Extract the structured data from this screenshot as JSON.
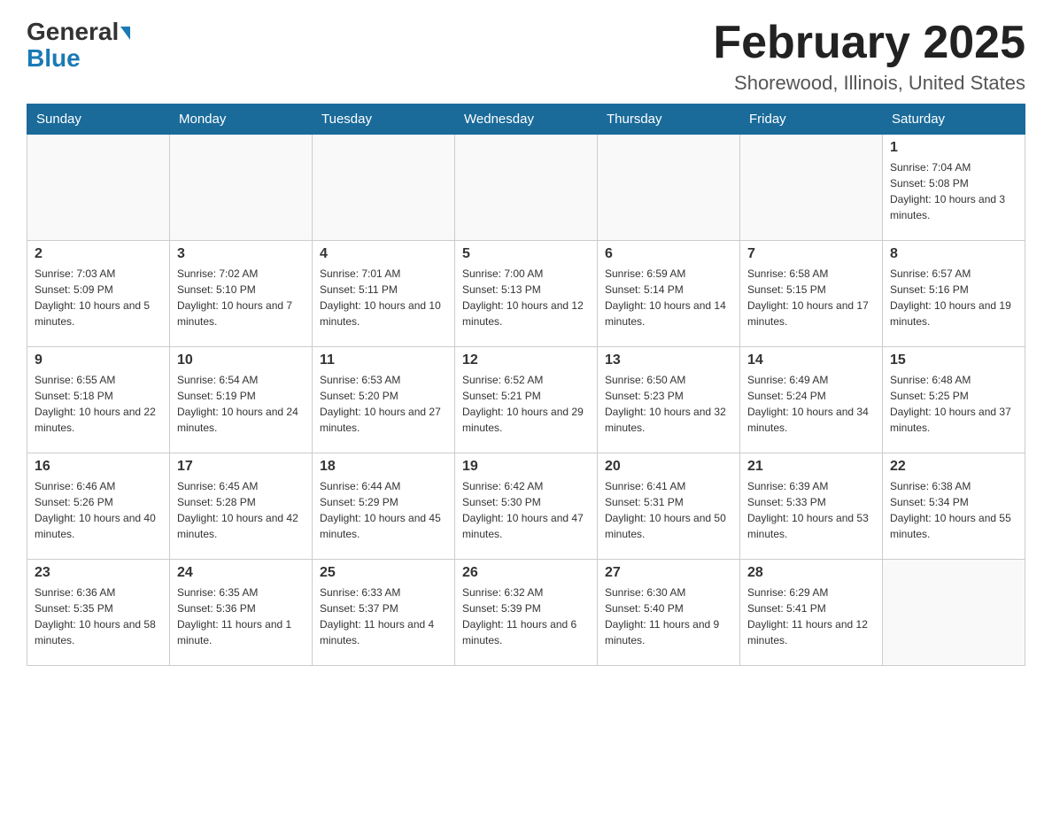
{
  "logo": {
    "general": "General",
    "blue": "Blue"
  },
  "header": {
    "month_year": "February 2025",
    "location": "Shorewood, Illinois, United States"
  },
  "weekdays": [
    "Sunday",
    "Monday",
    "Tuesday",
    "Wednesday",
    "Thursday",
    "Friday",
    "Saturday"
  ],
  "weeks": [
    [
      {
        "day": "",
        "info": ""
      },
      {
        "day": "",
        "info": ""
      },
      {
        "day": "",
        "info": ""
      },
      {
        "day": "",
        "info": ""
      },
      {
        "day": "",
        "info": ""
      },
      {
        "day": "",
        "info": ""
      },
      {
        "day": "1",
        "info": "Sunrise: 7:04 AM\nSunset: 5:08 PM\nDaylight: 10 hours and 3 minutes."
      }
    ],
    [
      {
        "day": "2",
        "info": "Sunrise: 7:03 AM\nSunset: 5:09 PM\nDaylight: 10 hours and 5 minutes."
      },
      {
        "day": "3",
        "info": "Sunrise: 7:02 AM\nSunset: 5:10 PM\nDaylight: 10 hours and 7 minutes."
      },
      {
        "day": "4",
        "info": "Sunrise: 7:01 AM\nSunset: 5:11 PM\nDaylight: 10 hours and 10 minutes."
      },
      {
        "day": "5",
        "info": "Sunrise: 7:00 AM\nSunset: 5:13 PM\nDaylight: 10 hours and 12 minutes."
      },
      {
        "day": "6",
        "info": "Sunrise: 6:59 AM\nSunset: 5:14 PM\nDaylight: 10 hours and 14 minutes."
      },
      {
        "day": "7",
        "info": "Sunrise: 6:58 AM\nSunset: 5:15 PM\nDaylight: 10 hours and 17 minutes."
      },
      {
        "day": "8",
        "info": "Sunrise: 6:57 AM\nSunset: 5:16 PM\nDaylight: 10 hours and 19 minutes."
      }
    ],
    [
      {
        "day": "9",
        "info": "Sunrise: 6:55 AM\nSunset: 5:18 PM\nDaylight: 10 hours and 22 minutes."
      },
      {
        "day": "10",
        "info": "Sunrise: 6:54 AM\nSunset: 5:19 PM\nDaylight: 10 hours and 24 minutes."
      },
      {
        "day": "11",
        "info": "Sunrise: 6:53 AM\nSunset: 5:20 PM\nDaylight: 10 hours and 27 minutes."
      },
      {
        "day": "12",
        "info": "Sunrise: 6:52 AM\nSunset: 5:21 PM\nDaylight: 10 hours and 29 minutes."
      },
      {
        "day": "13",
        "info": "Sunrise: 6:50 AM\nSunset: 5:23 PM\nDaylight: 10 hours and 32 minutes."
      },
      {
        "day": "14",
        "info": "Sunrise: 6:49 AM\nSunset: 5:24 PM\nDaylight: 10 hours and 34 minutes."
      },
      {
        "day": "15",
        "info": "Sunrise: 6:48 AM\nSunset: 5:25 PM\nDaylight: 10 hours and 37 minutes."
      }
    ],
    [
      {
        "day": "16",
        "info": "Sunrise: 6:46 AM\nSunset: 5:26 PM\nDaylight: 10 hours and 40 minutes."
      },
      {
        "day": "17",
        "info": "Sunrise: 6:45 AM\nSunset: 5:28 PM\nDaylight: 10 hours and 42 minutes."
      },
      {
        "day": "18",
        "info": "Sunrise: 6:44 AM\nSunset: 5:29 PM\nDaylight: 10 hours and 45 minutes."
      },
      {
        "day": "19",
        "info": "Sunrise: 6:42 AM\nSunset: 5:30 PM\nDaylight: 10 hours and 47 minutes."
      },
      {
        "day": "20",
        "info": "Sunrise: 6:41 AM\nSunset: 5:31 PM\nDaylight: 10 hours and 50 minutes."
      },
      {
        "day": "21",
        "info": "Sunrise: 6:39 AM\nSunset: 5:33 PM\nDaylight: 10 hours and 53 minutes."
      },
      {
        "day": "22",
        "info": "Sunrise: 6:38 AM\nSunset: 5:34 PM\nDaylight: 10 hours and 55 minutes."
      }
    ],
    [
      {
        "day": "23",
        "info": "Sunrise: 6:36 AM\nSunset: 5:35 PM\nDaylight: 10 hours and 58 minutes."
      },
      {
        "day": "24",
        "info": "Sunrise: 6:35 AM\nSunset: 5:36 PM\nDaylight: 11 hours and 1 minute."
      },
      {
        "day": "25",
        "info": "Sunrise: 6:33 AM\nSunset: 5:37 PM\nDaylight: 11 hours and 4 minutes."
      },
      {
        "day": "26",
        "info": "Sunrise: 6:32 AM\nSunset: 5:39 PM\nDaylight: 11 hours and 6 minutes."
      },
      {
        "day": "27",
        "info": "Sunrise: 6:30 AM\nSunset: 5:40 PM\nDaylight: 11 hours and 9 minutes."
      },
      {
        "day": "28",
        "info": "Sunrise: 6:29 AM\nSunset: 5:41 PM\nDaylight: 11 hours and 12 minutes."
      },
      {
        "day": "",
        "info": ""
      }
    ]
  ]
}
